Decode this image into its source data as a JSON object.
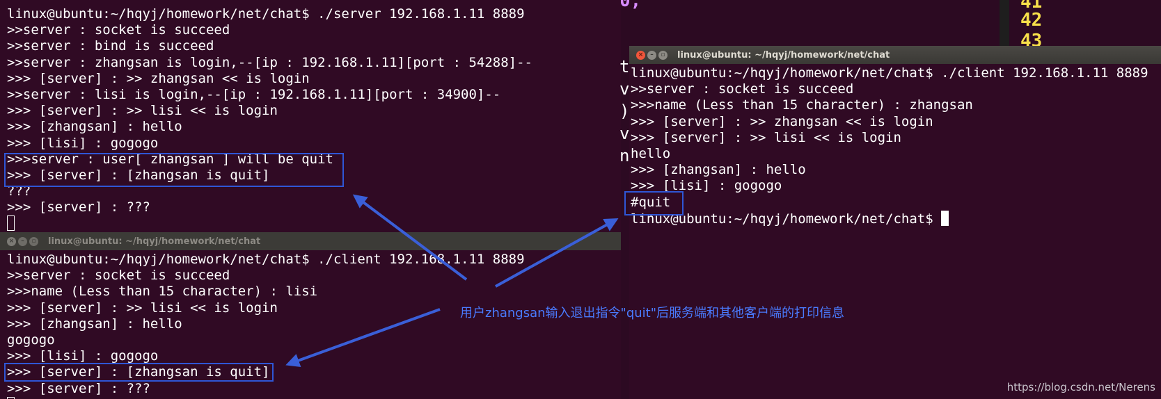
{
  "background_fragments": {
    "editor_numbers": [
      "41",
      "42",
      "43"
    ],
    "stray_chars": "t\nv\n)\nv\nn",
    "top_chars": "0,"
  },
  "server_terminal": {
    "lines": [
      "linux@ubuntu:~/hqyj/homework/net/chat$ ./server 192.168.1.11 8889",
      ">>server : socket is succeed",
      ">>server : bind is succeed",
      ">>server : zhangsan is login,--[ip : 192.168.1.11][port : 54288]--",
      ">>> [server] : >> zhangsan << is login",
      ">>server : lisi is login,--[ip : 192.168.1.11][port : 34900]--",
      ">>> [server] : >> lisi << is login",
      ">>> [zhangsan] : hello",
      ">>> [lisi] : gogogo",
      ">>>server : user[ zhangsan ] will be quit",
      ">>> [server] : [zhangsan is quit]",
      "???",
      ">>> [server] : ???"
    ]
  },
  "lisi_terminal": {
    "title": "linux@ubuntu: ~/hqyj/homework/net/chat",
    "lines": [
      "linux@ubuntu:~/hqyj/homework/net/chat$ ./client 192.168.1.11 8889",
      ">>server : socket is succeed",
      ">>>name (Less than 15 character) : lisi",
      ">>> [server] : >> lisi << is login",
      ">>> [zhangsan] : hello",
      "gogogo",
      ">>> [lisi] : gogogo",
      ">>> [server] : [zhangsan is quit]",
      ">>> [server] : ???"
    ]
  },
  "zhangsan_terminal": {
    "title": "linux@ubuntu: ~/hqyj/homework/net/chat",
    "lines": [
      "linux@ubuntu:~/hqyj/homework/net/chat$ ./client 192.168.1.11 8889",
      ">>server : socket is succeed",
      ">>>name (Less than 15 character) : zhangsan",
      ">>> [server] : >> zhangsan << is login",
      ">>> [server] : >> lisi << is login",
      "hello",
      ">>> [zhangsan] : hello",
      ">>> [lisi] : gogogo",
      "#quit",
      "linux@ubuntu:~/hqyj/homework/net/chat$ "
    ]
  },
  "annotation": {
    "text": "用户zhangsan输入退出指令\"quit\"后服务端和其他客户端的打印信息",
    "color": "#4a7bff"
  },
  "watermark": "https://blog.csdn.net/Nerens",
  "colors": {
    "terminal_bg": "#300a24",
    "highlight": "#2f56d6",
    "arrow": "#3a5fd8"
  }
}
